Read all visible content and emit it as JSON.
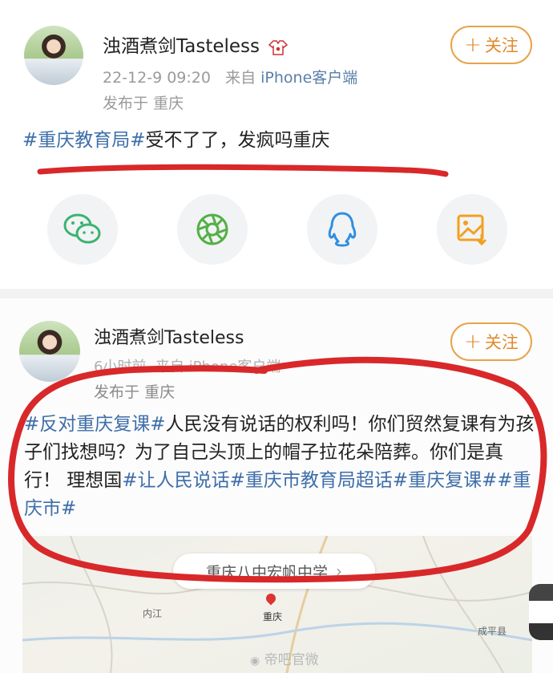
{
  "post1": {
    "username": "浊酒煮剑Tasteless",
    "badge_icon": "shirt-badge-icon",
    "time": "22-12-9 09:20",
    "from_prefix": "来自",
    "source": "iPhone客户端",
    "location_prefix": "发布于",
    "location": "重庆",
    "follow_label": "关注",
    "hashtag": "#重庆教育局#",
    "text": "受不了了，发疯吗重庆"
  },
  "share_icons": [
    "wechat-icon",
    "moments-icon",
    "qq-icon",
    "save-image-icon"
  ],
  "post2": {
    "username": "浊酒煮剑Tasteless",
    "time": "6小时前",
    "from_prefix": "来自",
    "source": "iPhone客户端",
    "location_prefix": "发布于",
    "location": "重庆",
    "follow_label": "关注",
    "tag1": "#反对重庆复课#",
    "text1": "人民没有说话的权利吗！你们贸然复课有为孩子们找想吗？为了自己头顶上的帽子拉花朵陪葬。你们是真行！ 理想国",
    "tag2": "#让人民说话#",
    "tag3": "重庆市教育局超话",
    "tag4": "#重庆复课#",
    "tag5": "#重庆市#",
    "map_location": "重庆八中宏帆中学",
    "map_places": [
      "内江",
      "重庆",
      "成平县"
    ]
  },
  "watermark": "帝吧官微",
  "annotation_color": "#d8282a"
}
